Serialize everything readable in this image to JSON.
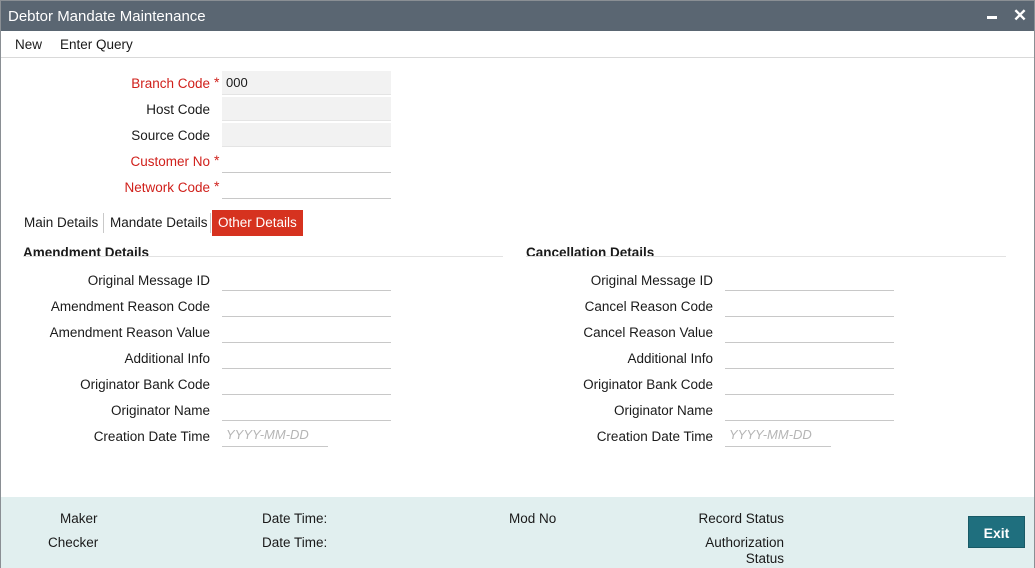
{
  "window": {
    "title": "Debtor Mandate Maintenance",
    "minimize_label": "−",
    "close_label": "✕"
  },
  "menu": {
    "new_label": "New",
    "enter_query_label": "Enter Query"
  },
  "header_fields": {
    "branch_code": {
      "label": "Branch Code",
      "value": "000"
    },
    "host_code": {
      "label": "Host Code",
      "value": ""
    },
    "source_code": {
      "label": "Source Code",
      "value": ""
    },
    "customer_no": {
      "label": "Customer No",
      "value": ""
    },
    "network_code": {
      "label": "Network Code",
      "value": ""
    },
    "required_marker": "*"
  },
  "tabs": [
    {
      "label": "Main Details"
    },
    {
      "label": "Mandate Details"
    },
    {
      "label": "Other Details"
    }
  ],
  "amendment": {
    "title": "Amendment Details",
    "original_message_id": "Original Message ID",
    "reason_code": "Amendment Reason Code",
    "reason_value": "Amendment Reason Value",
    "additional_info": "Additional Info",
    "originator_bank_code": "Originator Bank Code",
    "originator_name": "Originator Name",
    "creation_date_time": "Creation Date Time",
    "date_placeholder": "YYYY-MM-DD"
  },
  "cancellation": {
    "title": "Cancellation Details",
    "original_message_id": "Original Message ID",
    "reason_code": "Cancel Reason Code",
    "reason_value": "Cancel Reason Value",
    "additional_info": "Additional Info",
    "originator_bank_code": "Originator Bank Code",
    "originator_name": "Originator Name",
    "creation_date_time": "Creation Date Time",
    "date_placeholder": "YYYY-MM-DD"
  },
  "footer": {
    "maker": "Maker",
    "checker": "Checker",
    "date_time_1": "Date Time:",
    "date_time_2": "Date Time:",
    "mod_no": "Mod No",
    "record_status": "Record Status",
    "authorization_status_line1": "Authorization",
    "authorization_status_line2": "Status",
    "exit_label": "Exit"
  }
}
